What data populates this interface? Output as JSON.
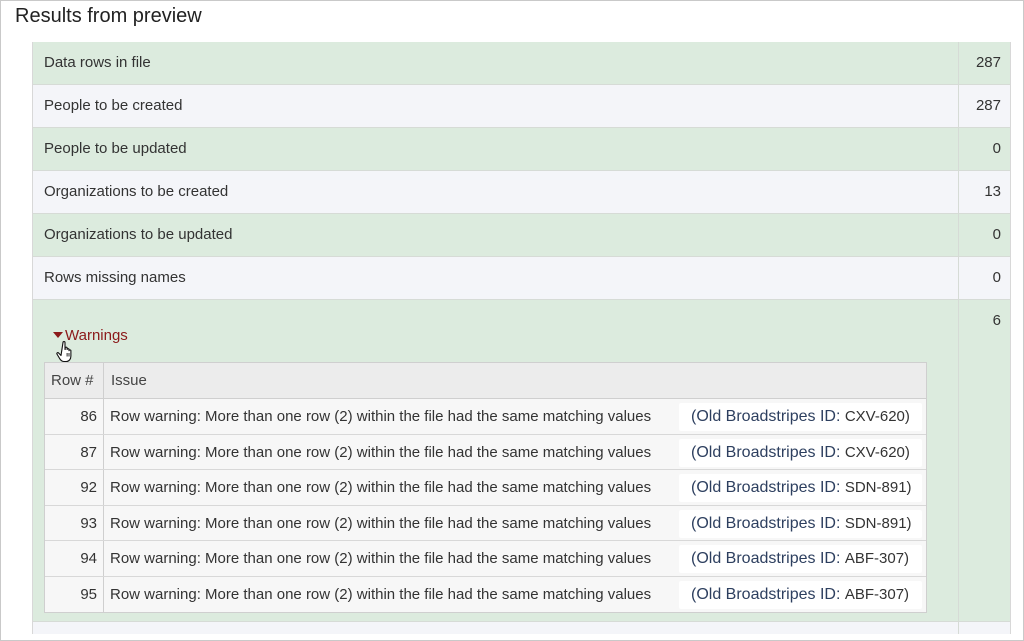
{
  "title": "Results from preview",
  "summary_rows": [
    {
      "label": "Data rows in file",
      "count": "287"
    },
    {
      "label": "People to be created",
      "count": "287"
    },
    {
      "label": "People to be updated",
      "count": "0"
    },
    {
      "label": "Organizations to be created",
      "count": "13"
    },
    {
      "label": "Organizations to be updated",
      "count": "0"
    },
    {
      "label": "Rows missing names",
      "count": "0"
    }
  ],
  "warnings": {
    "toggle_label": "Warnings",
    "count": "6",
    "columns": {
      "row_num": "Row #",
      "issue": "Issue"
    },
    "rows": [
      {
        "row": "86",
        "message": "Row warning: More than one row (2) within the file had the same matching values",
        "id_label": "(Old Broadstripes ID:",
        "id_value": "CXV-620)"
      },
      {
        "row": "87",
        "message": "Row warning: More than one row (2) within the file had the same matching values",
        "id_label": "(Old Broadstripes ID:",
        "id_value": "CXV-620)"
      },
      {
        "row": "92",
        "message": "Row warning: More than one row (2) within the file had the same matching values",
        "id_label": "(Old Broadstripes ID:",
        "id_value": "SDN-891)"
      },
      {
        "row": "93",
        "message": "Row warning: More than one row (2) within the file had the same matching values",
        "id_label": "(Old Broadstripes ID:",
        "id_value": "SDN-891)"
      },
      {
        "row": "94",
        "message": "Row warning: More than one row (2) within the file had the same matching values",
        "id_label": "(Old Broadstripes ID:",
        "id_value": "ABF-307)"
      },
      {
        "row": "95",
        "message": "Row warning: More than one row (2) within the file had the same matching values",
        "id_label": "(Old Broadstripes ID:",
        "id_value": "ABF-307)"
      }
    ]
  },
  "icons": {
    "toggle": "caret-down-icon",
    "cursor": "hand-pointer-cursor-icon"
  },
  "colors": {
    "success_row": "#dcebde",
    "alt_row": "#f4f5f9",
    "warning_link": "#8b1a1a",
    "id_text": "#2d3f5f"
  }
}
